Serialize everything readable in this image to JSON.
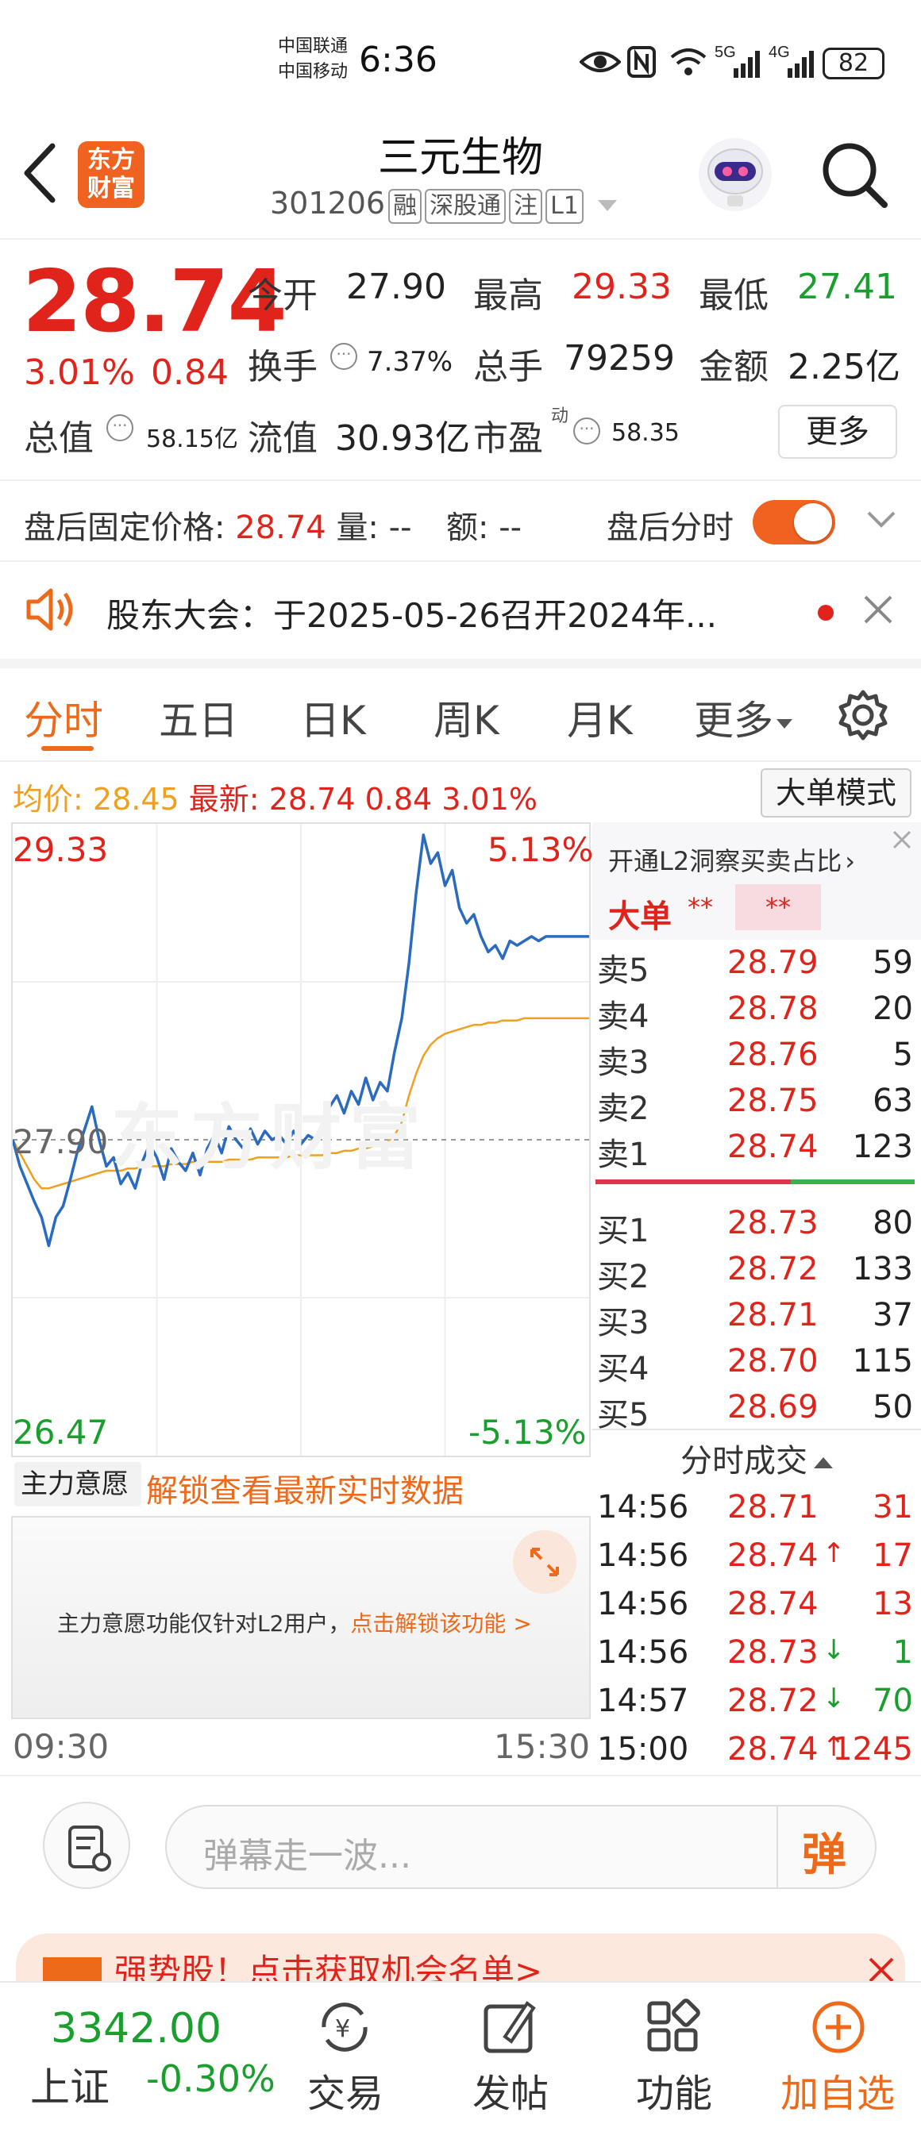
{
  "status_bar": {
    "carrier1": "中国联通",
    "carrier2": "中国移动",
    "time": "6:36",
    "signal1": "5G",
    "signal2": "4G",
    "battery": "82"
  },
  "header": {
    "back_icon": "chevron-left-icon",
    "logo_text_line1": "东方",
    "logo_text_line2": "财富",
    "title": "三元生物",
    "code": "301206",
    "tags": [
      "融",
      "深股通",
      "注",
      "L1"
    ]
  },
  "quote": {
    "price": "28.74",
    "change_pct": "3.01%",
    "change": "0.84",
    "open_label": "今开",
    "open": "27.90",
    "high_label": "最高",
    "high": "29.33",
    "low_label": "最低",
    "low": "27.41",
    "turnover_label": "换手",
    "turnover": "7.37%",
    "volume_label": "总手",
    "volume": "79259",
    "amount_label": "金额",
    "amount": "2.25亿",
    "mktcap_label": "总值",
    "mktcap": "58.15亿",
    "float_label": "流值",
    "float": "30.93亿",
    "pe_label": "市盈",
    "pe_sup": "动",
    "pe": "58.35",
    "more": "更多"
  },
  "after_hours": {
    "label": "盘后固定价格:",
    "price": "28.74",
    "vol_label": "量:",
    "vol": "--",
    "amt_label": "额:",
    "amt": "--",
    "toggle_label": "盘后分时"
  },
  "notice": {
    "text": "股东大会：于2025-05-26召开2024年..."
  },
  "tabs": [
    "分时",
    "五日",
    "日K",
    "周K",
    "月K",
    "更多"
  ],
  "intraday_header": {
    "avg_label": "均价:",
    "avg": "28.45",
    "latest_label": "最新:",
    "latest": "28.74",
    "change": "0.84",
    "change_pct": "3.01%",
    "mode_button": "大单模式"
  },
  "chart_labels": {
    "top_price": "29.33",
    "top_pct": "5.13%",
    "mid_price": "27.90",
    "bottom_price": "26.47",
    "bottom_pct": "-5.13%",
    "time_start": "09:30",
    "time_end": "15:30",
    "watermark": "东方财富"
  },
  "chart_data": {
    "type": "line",
    "ylim": [
      26.47,
      29.33
    ],
    "prev_close": 27.9,
    "series": [
      {
        "values": [
          27.9,
          27.78,
          27.7,
          27.62,
          27.55,
          27.42,
          27.55,
          27.6,
          27.72,
          27.85,
          27.95,
          28.05,
          27.9,
          27.78,
          27.82,
          27.7,
          27.75,
          27.68,
          27.8,
          27.88,
          27.82,
          27.72,
          27.86,
          27.8,
          27.76,
          27.84,
          27.74,
          27.86,
          27.92,
          27.84,
          27.96,
          27.9,
          27.86,
          27.95,
          27.88,
          27.94,
          27.9,
          27.92,
          27.88,
          27.94,
          27.88,
          27.92,
          27.9,
          27.94,
          28.05,
          28.1,
          28.02,
          28.12,
          28.06,
          28.18,
          28.08,
          28.16,
          28.12,
          28.3,
          28.45,
          28.7,
          29.02,
          29.28,
          29.15,
          29.2,
          29.05,
          29.12,
          28.95,
          28.88,
          28.92,
          28.82,
          28.75,
          28.78,
          28.72,
          28.8,
          28.78,
          28.8,
          28.82,
          28.8,
          28.82,
          28.82,
          28.82,
          28.82,
          28.82,
          28.82,
          28.82
        ]
      },
      {
        "values": [
          27.9,
          27.84,
          27.78,
          27.72,
          27.68,
          27.68,
          27.69,
          27.7,
          27.71,
          27.72,
          27.73,
          27.74,
          27.75,
          27.76,
          27.76,
          27.76,
          27.77,
          27.77,
          27.78,
          27.78,
          27.78,
          27.78,
          27.79,
          27.79,
          27.79,
          27.8,
          27.8,
          27.8,
          27.8,
          27.8,
          27.81,
          27.81,
          27.81,
          27.81,
          27.82,
          27.82,
          27.82,
          27.82,
          27.82,
          27.83,
          27.83,
          27.83,
          27.83,
          27.83,
          27.84,
          27.84,
          27.85,
          27.85,
          27.86,
          27.86,
          27.87,
          27.88,
          27.89,
          27.92,
          27.98,
          28.1,
          28.2,
          28.28,
          28.33,
          28.36,
          28.38,
          28.39,
          28.4,
          28.41,
          28.42,
          28.42,
          28.43,
          28.43,
          28.44,
          28.44,
          28.44,
          28.45,
          28.45,
          28.45,
          28.45,
          28.45,
          28.45,
          28.45,
          28.45,
          28.45,
          28.45
        ]
      }
    ]
  },
  "l2_panel": {
    "title": "开通L2洞察买卖占比",
    "big_order_label": "大单",
    "big_order_val": "**",
    "big_order_val2": "**"
  },
  "order_book": {
    "sells": [
      {
        "label": "卖5",
        "price": "28.79",
        "vol": "59"
      },
      {
        "label": "卖4",
        "price": "28.78",
        "vol": "20"
      },
      {
        "label": "卖3",
        "price": "28.76",
        "vol": "5"
      },
      {
        "label": "卖2",
        "price": "28.75",
        "vol": "63"
      },
      {
        "label": "卖1",
        "price": "28.74",
        "vol": "123"
      }
    ],
    "buys": [
      {
        "label": "买1",
        "price": "28.73",
        "vol": "80"
      },
      {
        "label": "买2",
        "price": "28.72",
        "vol": "133"
      },
      {
        "label": "买3",
        "price": "28.71",
        "vol": "37"
      },
      {
        "label": "买4",
        "price": "28.70",
        "vol": "115"
      },
      {
        "label": "买5",
        "price": "28.69",
        "vol": "50"
      }
    ]
  },
  "trades": {
    "title": "分时成交",
    "rows": [
      {
        "time": "14:56",
        "price": "28.71",
        "dir": "",
        "vol": "31",
        "color": "#e0241b"
      },
      {
        "time": "14:56",
        "price": "28.74",
        "dir": "↑",
        "vol": "17",
        "color": "#e0241b"
      },
      {
        "time": "14:56",
        "price": "28.74",
        "dir": "",
        "vol": "13",
        "color": "#e0241b"
      },
      {
        "time": "14:56",
        "price": "28.73",
        "dir": "↓",
        "vol": "1",
        "color": "#1a9e2e"
      },
      {
        "time": "14:57",
        "price": "28.72",
        "dir": "↓",
        "vol": "70",
        "color": "#1a9e2e"
      },
      {
        "time": "15:00",
        "price": "28.74",
        "dir": "↑",
        "vol": "1245",
        "color": "#e0241b"
      }
    ]
  },
  "main_force": {
    "dropdown": "主力意愿",
    "unlock_link": "解锁查看最新实时数据",
    "notice": "主力意愿功能仅针对L2用户，",
    "notice_link": "点击解锁该功能 >"
  },
  "comment_bar": {
    "placeholder": "弹幕走一波...",
    "danmu_button": "弹"
  },
  "promo": {
    "text": "强势股！点击获取机会名单>"
  },
  "bottom_nav": {
    "index_value": "3342.00",
    "index_name": "上证",
    "index_change": "-0.30%",
    "items": [
      "交易",
      "发帖",
      "功能",
      "加自选"
    ]
  },
  "colors": {
    "up": "#e0241b",
    "down": "#1a9e2e",
    "accent": "#ee6a1b",
    "avg_line": "#f0a020",
    "price_line": "#2a6bc0"
  }
}
